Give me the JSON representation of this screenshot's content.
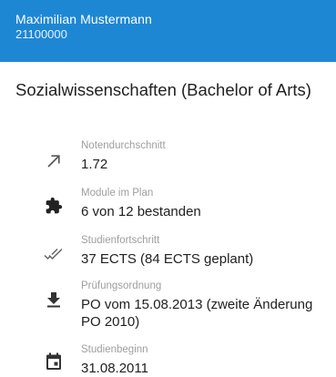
{
  "header": {
    "name": "Maximilian Mustermann",
    "student_number": "21100000",
    "background_color": "#1e87d4"
  },
  "degree": "Sozialwissenschaften (Bachelor of Arts)",
  "details": [
    {
      "icon": "trending-arrow-icon",
      "label": "Notendurchschnitt",
      "value": "1.72"
    },
    {
      "icon": "puzzle-piece-icon",
      "label": "Module im Plan",
      "value": "6 von 12 bestanden"
    },
    {
      "icon": "double-check-icon",
      "label": "Studienfortschritt",
      "value": "37 ECTS (84 ECTS geplant)"
    },
    {
      "icon": "download-icon",
      "label": "Prüfungsordnung",
      "value": "PO vom 15.08.2013 (zweite Änderung PO 2010)"
    },
    {
      "icon": "calendar-icon",
      "label": "Studienbeginn",
      "value": "31.08.2011"
    }
  ]
}
